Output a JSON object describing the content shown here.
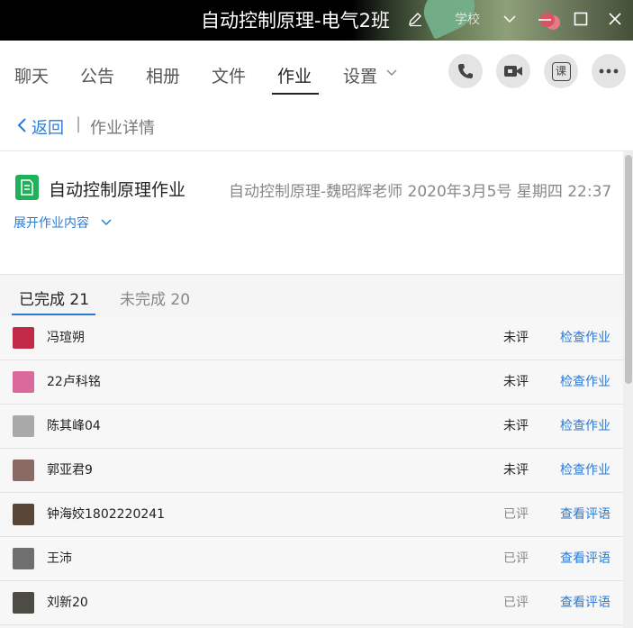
{
  "window": {
    "title": "自动控制原理-电气2班",
    "faded_label": "学校"
  },
  "nav": {
    "tabs": [
      "聊天",
      "公告",
      "相册",
      "文件",
      "作业",
      "设置"
    ],
    "active_tab": "作业",
    "course_button_label": "课"
  },
  "subheader": {
    "back_label": "返回",
    "separator": "|",
    "crumb": "作业详情"
  },
  "homework": {
    "title": "自动控制原理作业",
    "meta": "自动控制原理-魏昭辉老师 2020年3月5号 星期四 22:37",
    "expand_label": "展开作业内容"
  },
  "status_tabs": {
    "completed": "已完成 21",
    "incomplete": "未完成 20"
  },
  "rows": [
    {
      "name": "冯瑄朔",
      "grade": "未评",
      "action": "检查作业",
      "avatar_color": "#c02a47"
    },
    {
      "name": "22卢科铭",
      "grade": "未评",
      "action": "检查作业",
      "avatar_color": "#d96a9b"
    },
    {
      "name": "陈其峰04",
      "grade": "未评",
      "action": "检查作业",
      "avatar_color": "#a9a9a9"
    },
    {
      "name": "郭亚君9",
      "grade": "未评",
      "action": "检查作业",
      "avatar_color": "#8c6a64"
    },
    {
      "name": "钟海姣1802220241",
      "grade": "已评",
      "action": "查看评语",
      "avatar_color": "#5a4636"
    },
    {
      "name": "王沛",
      "grade": "已评",
      "action": "查看评语",
      "avatar_color": "#6f6f6f"
    },
    {
      "name": "刘新20",
      "grade": "已评",
      "action": "查看评语",
      "avatar_color": "#4c4c44"
    }
  ],
  "colors": {
    "accent": "#2b7bd6",
    "doc_icon": "#21b15a",
    "ungraded_text": "#222222",
    "graded_text": "#888888"
  }
}
